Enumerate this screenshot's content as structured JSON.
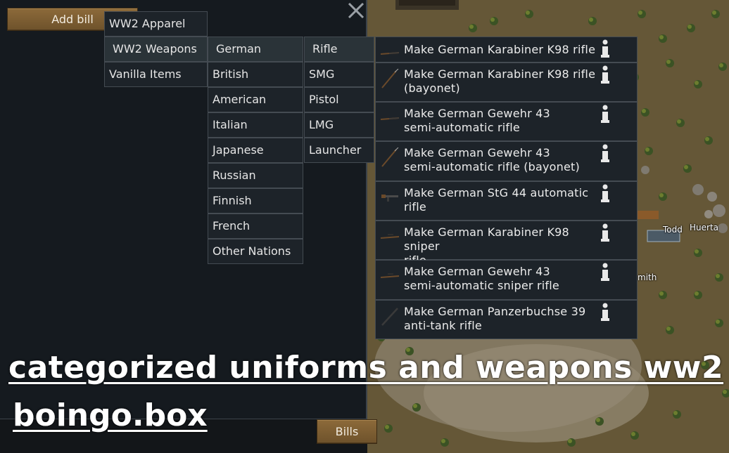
{
  "panel": {
    "add_bill_label": "Add bill",
    "bills_label": "Bills",
    "close_icon": "close-x-icon"
  },
  "menu_level1": [
    "WW2 Apparel",
    "WW2 Weapons",
    "Vanilla Items"
  ],
  "menu_level2": [
    "German",
    "British",
    "American",
    "Italian",
    "Japanese",
    "Russian",
    "Finnish",
    "French",
    "Other Nations"
  ],
  "menu_level3": [
    "Rifle",
    "SMG",
    "Pistol",
    "LMG",
    "Launcher"
  ],
  "weapons": [
    {
      "line1": "Make German Karabiner K98 rifle",
      "line2": "",
      "icon": "rifle-icon"
    },
    {
      "line1": "Make German Karabiner K98 rifle",
      "line2": "(bayonet)",
      "icon": "bayonet-rifle-icon"
    },
    {
      "line1": "Make German Gewehr 43",
      "line2": "semi-automatic rifle",
      "icon": "rifle-icon"
    },
    {
      "line1": "Make German Gewehr 43",
      "line2": "semi-automatic rifle (bayonet)",
      "icon": "bayonet-rifle-icon"
    },
    {
      "line1": "Make German StG 44 automatic",
      "line2": "rifle",
      "icon": "assault-rifle-icon"
    },
    {
      "line1": "Make German Karabiner K98 sniper",
      "line2": "rifle",
      "icon": "sniper-rifle-icon"
    },
    {
      "line1": "Make German Gewehr 43",
      "line2": "semi-automatic sniper rifle",
      "icon": "sniper-rifle-icon"
    },
    {
      "line1": "Make German Panzerbuchse 39",
      "line2": "anti-tank rifle",
      "icon": "antitank-rifle-icon"
    }
  ],
  "map_labels": {
    "pawn1": "Todd",
    "pawn2": "Huerta",
    "pawn3": "mith"
  },
  "overlay": {
    "title": "categorized uniforms and weapons ww2",
    "site": "boingo.box"
  },
  "colors": {
    "wood_button": "#7d5e33",
    "panel_bg": "#151a1f",
    "menu_bg": "#1d2329",
    "menu_border": "#444b52",
    "ground": "#6b5a36"
  }
}
